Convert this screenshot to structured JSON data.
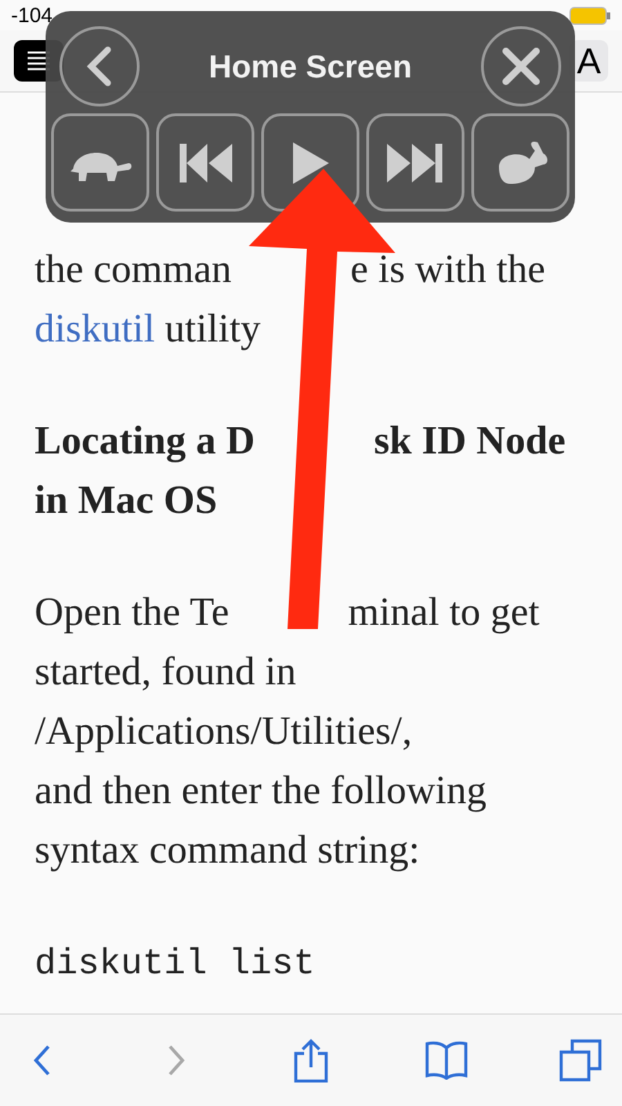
{
  "status_bar": {
    "signal": "-104"
  },
  "nav_bar": {
    "aa_label": "A"
  },
  "speak_controls": {
    "title": "Home Screen",
    "buttons": [
      {
        "kind": "slower"
      },
      {
        "kind": "previous"
      },
      {
        "kind": "play"
      },
      {
        "kind": "next"
      },
      {
        "kind": "faster"
      }
    ]
  },
  "article": {
    "lines": [
      {
        "kind": "text",
        "segments": [
          {
            "text": "the comman"
          }
        ],
        "continuation": "e is with the"
      },
      {
        "kind": "text",
        "segments": [
          {
            "text": "diskutil",
            "link": true
          },
          {
            "text": " utility",
            "link": false
          }
        ]
      },
      {
        "kind": "blank"
      },
      {
        "kind": "heading",
        "segments": [
          {
            "text": "Locating a D"
          }
        ],
        "continuation": "sk ID Node"
      },
      {
        "kind": "heading",
        "segments": [
          {
            "text": "in Mac OS"
          }
        ]
      },
      {
        "kind": "blank"
      },
      {
        "kind": "text",
        "segments": [
          {
            "text": "Open the Te"
          }
        ],
        "continuation": "minal to get"
      },
      {
        "kind": "text",
        "segments": [
          {
            "text": "started, found in"
          }
        ]
      },
      {
        "kind": "text",
        "segments": [
          {
            "text": "/Applications/Utilities/,"
          }
        ]
      },
      {
        "kind": "text",
        "segments": [
          {
            "text": "and then enter the following"
          }
        ]
      },
      {
        "kind": "text",
        "segments": [
          {
            "text": "syntax command string:"
          }
        ]
      },
      {
        "kind": "blank"
      },
      {
        "kind": "code",
        "segments": [
          {
            "text": "diskutil list"
          }
        ]
      }
    ]
  },
  "toolbar": [
    {
      "kind": "back",
      "disabled": false
    },
    {
      "kind": "forward",
      "disabled": true
    },
    {
      "kind": "share",
      "disabled": false
    },
    {
      "kind": "bookmarks",
      "disabled": false
    },
    {
      "kind": "tabs",
      "disabled": false
    }
  ]
}
